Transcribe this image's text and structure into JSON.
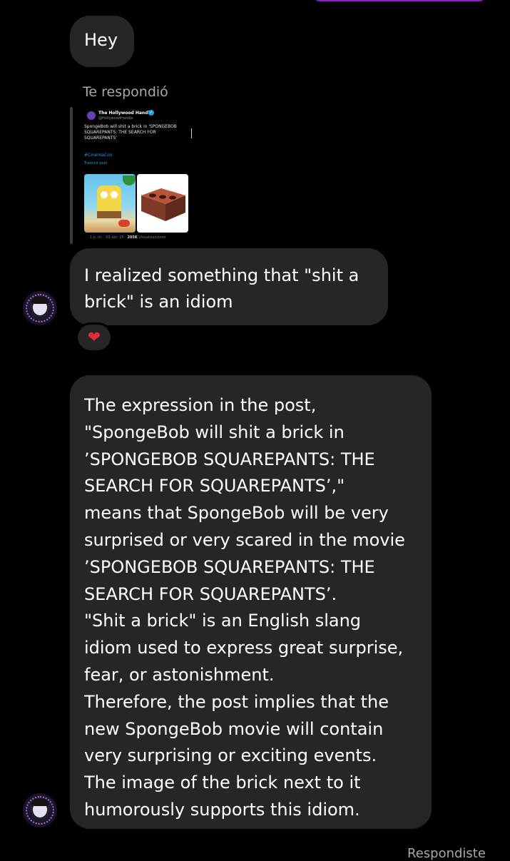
{
  "colors": {
    "background": "#000000",
    "bubble_received": "#262626",
    "sent_bubble_edge": "#8a21c9",
    "secondary_text": "#a8a8a8",
    "heart": "#e02b3c",
    "link_blue": "#1d9bf0"
  },
  "messages": {
    "hey": "Hey",
    "reply_label": "Te respondió",
    "shared_post": {
      "account_name": "The Hollywood Handle",
      "verified_icon": "verified-badge-icon",
      "handle": "@HollywoodHandle",
      "text": "SpongeBob will shit a brick in 'SPONGEBOB SQUAREPANTS: THE SEARCH FOR SQUAREPANTS'",
      "hashtag": "#CinemaCon",
      "translate": "Traducir post",
      "time": "1 p. m. · 03 abr. 25 ·",
      "views": "205K",
      "views_label": "Visualizaciones",
      "images": [
        "spongebob-image",
        "brick-image"
      ]
    },
    "realized": {
      "lines": [
        "I realized something that \"shit a",
        "brick\" is an idiom"
      ]
    },
    "reaction": {
      "icon": "heart-icon",
      "glyph": "❤"
    },
    "explanation": {
      "lines": [
        "The expression in the post,",
        "\"SpongeBob will shit a brick in",
        "’SPONGEBOB SQUAREPANTS: THE",
        "SEARCH FOR SQUAREPANTS’,\"",
        "means that SpongeBob will be very",
        "surprised or very scared in the movie",
        "’SPONGEBOB SQUAREPANTS: THE",
        "SEARCH FOR SQUAREPANTS’.",
        "\"Shit a brick\" is an English slang",
        "idiom used to express great surprise,",
        "fear, or astonishment.",
        "Therefore, the post implies that the",
        "new SpongeBob movie will contain",
        "very surprising or exciting events.",
        "The image of the brick next to it",
        "humorously supports this idiom."
      ]
    }
  },
  "footer": {
    "status": "Respondiste"
  }
}
